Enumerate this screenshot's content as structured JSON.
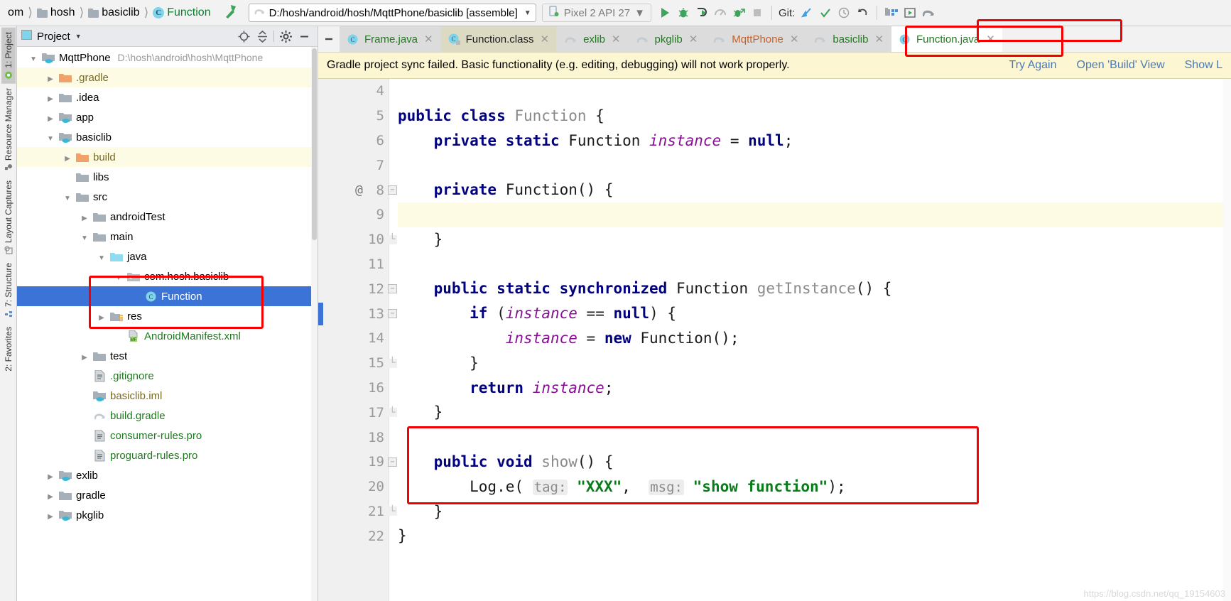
{
  "toolbar": {
    "breadcrumbs": [
      {
        "label": "om",
        "icon": "none"
      },
      {
        "label": "hosh",
        "icon": "folder-icon"
      },
      {
        "label": "basiclib",
        "icon": "folder-icon"
      },
      {
        "label": "Function",
        "icon": "class-icon"
      }
    ],
    "hammer_icon": "build-hammer-icon",
    "run_config": "D:/hosh/android/hosh/MqttPhone/basiclib [assemble]",
    "device": "Pixel 2 API 27",
    "icons": [
      "run-icon",
      "debug-icon",
      "run-with-coverage-icon",
      "profiler-icon",
      "attach-debugger-icon",
      "stop-icon"
    ],
    "git_label": "Git:",
    "git_icons": [
      "update-project-icon",
      "commit-icon",
      "history-icon",
      "rollback-icon"
    ],
    "right_icons": [
      "avd-manager-icon",
      "sdk-manager-icon",
      "gradle-sync-icon"
    ]
  },
  "vertical_tabs": [
    {
      "label": "1: Project",
      "icon": "project-icon",
      "active": true
    },
    {
      "label": "Resource Manager",
      "icon": "resource-manager-icon",
      "active": false
    },
    {
      "label": "Layout Captures",
      "icon": "layout-captures-icon",
      "active": false
    },
    {
      "label": "7: Structure",
      "icon": "structure-icon",
      "active": false
    },
    {
      "label": "2: Favorites",
      "icon": "favorites-icon",
      "active": false
    }
  ],
  "project_panel": {
    "title": "Project",
    "header_icons": [
      "locate-icon",
      "collapse-all-icon",
      "gear-icon",
      "hide-icon"
    ],
    "tree": [
      {
        "label": "MqttPhone",
        "path": "D:\\hosh\\android\\hosh\\MqttPhone",
        "indent": 0,
        "twisty": "down",
        "icon": "module-icon",
        "color": "dark",
        "state": "normal"
      },
      {
        "label": ".gradle",
        "path": "",
        "indent": 1,
        "twisty": "right",
        "icon": "orange-folder-icon",
        "color": "olive",
        "state": "yellow"
      },
      {
        "label": ".idea",
        "path": "",
        "indent": 1,
        "twisty": "right",
        "icon": "folder-icon",
        "color": "dark",
        "state": "normal"
      },
      {
        "label": "app",
        "path": "",
        "indent": 1,
        "twisty": "right",
        "icon": "module-icon",
        "color": "dark",
        "state": "normal"
      },
      {
        "label": "basiclib",
        "path": "",
        "indent": 1,
        "twisty": "down",
        "icon": "module-icon",
        "color": "dark",
        "state": "normal"
      },
      {
        "label": "build",
        "path": "",
        "indent": 2,
        "twisty": "right",
        "icon": "orange-folder-icon",
        "color": "olive",
        "state": "yellow"
      },
      {
        "label": "libs",
        "path": "",
        "indent": 2,
        "twisty": "none",
        "icon": "folder-icon",
        "color": "dark",
        "state": "normal"
      },
      {
        "label": "src",
        "path": "",
        "indent": 2,
        "twisty": "down",
        "icon": "folder-icon",
        "color": "dark",
        "state": "normal"
      },
      {
        "label": "androidTest",
        "path": "",
        "indent": 3,
        "twisty": "right",
        "icon": "folder-icon",
        "color": "dark",
        "state": "normal"
      },
      {
        "label": "main",
        "path": "",
        "indent": 3,
        "twisty": "down",
        "icon": "folder-icon",
        "color": "dark",
        "state": "normal"
      },
      {
        "label": "java",
        "path": "",
        "indent": 4,
        "twisty": "down",
        "icon": "source-folder-icon",
        "color": "dark",
        "state": "normal"
      },
      {
        "label": "com.hosh.basiclib",
        "path": "",
        "indent": 5,
        "twisty": "down",
        "icon": "package-icon",
        "color": "dark",
        "state": "normal"
      },
      {
        "label": "Function",
        "path": "",
        "indent": 6,
        "twisty": "none",
        "icon": "class-icon",
        "color": "dark",
        "state": "selected"
      },
      {
        "label": "res",
        "path": "",
        "indent": 4,
        "twisty": "right",
        "icon": "res-folder-icon",
        "color": "dark",
        "state": "normal"
      },
      {
        "label": "AndroidManifest.xml",
        "path": "",
        "indent": 5,
        "twisty": "none",
        "icon": "manifest-icon",
        "color": "green",
        "state": "normal"
      },
      {
        "label": "test",
        "path": "",
        "indent": 3,
        "twisty": "right",
        "icon": "folder-icon",
        "color": "dark",
        "state": "normal"
      },
      {
        "label": ".gitignore",
        "path": "",
        "indent": 3,
        "twisty": "none",
        "icon": "file-icon",
        "color": "green",
        "state": "normal"
      },
      {
        "label": "basiclib.iml",
        "path": "",
        "indent": 3,
        "twisty": "none",
        "icon": "module-icon",
        "color": "olive",
        "state": "normal"
      },
      {
        "label": "build.gradle",
        "path": "",
        "indent": 3,
        "twisty": "none",
        "icon": "gradle-icon",
        "color": "green",
        "state": "normal"
      },
      {
        "label": "consumer-rules.pro",
        "path": "",
        "indent": 3,
        "twisty": "none",
        "icon": "file-icon",
        "color": "green",
        "state": "normal"
      },
      {
        "label": "proguard-rules.pro",
        "path": "",
        "indent": 3,
        "twisty": "none",
        "icon": "file-icon",
        "color": "green",
        "state": "normal"
      },
      {
        "label": "exlib",
        "path": "",
        "indent": 1,
        "twisty": "right",
        "icon": "module-icon",
        "color": "dark",
        "state": "normal"
      },
      {
        "label": "gradle",
        "path": "",
        "indent": 1,
        "twisty": "right",
        "icon": "folder-icon",
        "color": "dark",
        "state": "normal"
      },
      {
        "label": "pkglib",
        "path": "",
        "indent": 1,
        "twisty": "right",
        "icon": "module-icon",
        "color": "dark",
        "state": "normal"
      }
    ]
  },
  "editor_tabs": [
    {
      "label": "Frame.java",
      "icon": "class-icon",
      "color": "green",
      "state": "inactive"
    },
    {
      "label": "Function.class",
      "icon": "class-file-icon",
      "color": "dark",
      "state": "class-active"
    },
    {
      "label": "exlib",
      "icon": "gradle-icon",
      "color": "green",
      "state": "inactive"
    },
    {
      "label": "pkglib",
      "icon": "gradle-icon",
      "color": "green",
      "state": "inactive"
    },
    {
      "label": "MqttPhone",
      "icon": "gradle-icon",
      "color": "orange",
      "state": "inactive"
    },
    {
      "label": "basiclib",
      "icon": "gradle-icon",
      "color": "green",
      "state": "inactive"
    },
    {
      "label": "Function.java",
      "icon": "class-icon",
      "color": "green",
      "state": "active"
    }
  ],
  "banner": {
    "message": "Gradle project sync failed. Basic functionality (e.g. editing, debugging) will not work properly.",
    "actions": [
      "Try Again",
      "Open 'Build' View",
      "Show L"
    ]
  },
  "editor": {
    "lines": [
      {
        "n": "4",
        "ann": "",
        "fold": "none",
        "highlight": false,
        "tokens": []
      },
      {
        "n": "5",
        "ann": "",
        "fold": "none",
        "highlight": false,
        "tokens": [
          {
            "t": "public class ",
            "c": "kw"
          },
          {
            "t": "Function ",
            "c": "id-gray"
          },
          {
            "t": "{",
            "c": "plain"
          }
        ]
      },
      {
        "n": "6",
        "ann": "",
        "fold": "none",
        "highlight": false,
        "tokens": [
          {
            "t": "    ",
            "c": "plain"
          },
          {
            "t": "private static ",
            "c": "kw"
          },
          {
            "t": "Function ",
            "c": "plain"
          },
          {
            "t": "instance",
            "c": "fld"
          },
          {
            "t": " = ",
            "c": "plain"
          },
          {
            "t": "null",
            "c": "kw"
          },
          {
            "t": ";",
            "c": "plain"
          }
        ]
      },
      {
        "n": "7",
        "ann": "",
        "fold": "none",
        "highlight": false,
        "tokens": []
      },
      {
        "n": "8",
        "ann": "@",
        "fold": "minus",
        "highlight": false,
        "tokens": [
          {
            "t": "    ",
            "c": "plain"
          },
          {
            "t": "private ",
            "c": "kw"
          },
          {
            "t": "Function() {",
            "c": "plain"
          }
        ]
      },
      {
        "n": "9",
        "ann": "",
        "fold": "none",
        "highlight": true,
        "tokens": []
      },
      {
        "n": "10",
        "ann": "",
        "fold": "end",
        "highlight": false,
        "tokens": [
          {
            "t": "    }",
            "c": "plain"
          }
        ]
      },
      {
        "n": "11",
        "ann": "",
        "fold": "none",
        "highlight": false,
        "tokens": []
      },
      {
        "n": "12",
        "ann": "",
        "fold": "minus",
        "highlight": false,
        "tokens": [
          {
            "t": "    ",
            "c": "plain"
          },
          {
            "t": "public static synchronized ",
            "c": "kw"
          },
          {
            "t": "Function ",
            "c": "plain"
          },
          {
            "t": "getInstance",
            "c": "id-gray"
          },
          {
            "t": "() {",
            "c": "plain"
          }
        ]
      },
      {
        "n": "13",
        "ann": "",
        "fold": "minus",
        "highlight": false,
        "tokens": [
          {
            "t": "        ",
            "c": "plain"
          },
          {
            "t": "if ",
            "c": "kw"
          },
          {
            "t": "(",
            "c": "plain"
          },
          {
            "t": "instance",
            "c": "fld"
          },
          {
            "t": " == ",
            "c": "plain"
          },
          {
            "t": "null",
            "c": "kw"
          },
          {
            "t": ") {",
            "c": "plain"
          }
        ]
      },
      {
        "n": "14",
        "ann": "",
        "fold": "none",
        "highlight": false,
        "tokens": [
          {
            "t": "            ",
            "c": "plain"
          },
          {
            "t": "instance",
            "c": "fld"
          },
          {
            "t": " = ",
            "c": "plain"
          },
          {
            "t": "new ",
            "c": "kw"
          },
          {
            "t": "Function();",
            "c": "plain"
          }
        ]
      },
      {
        "n": "15",
        "ann": "",
        "fold": "end",
        "highlight": false,
        "tokens": [
          {
            "t": "        }",
            "c": "plain"
          }
        ]
      },
      {
        "n": "16",
        "ann": "",
        "fold": "none",
        "highlight": false,
        "tokens": [
          {
            "t": "        ",
            "c": "plain"
          },
          {
            "t": "return ",
            "c": "kw"
          },
          {
            "t": "instance",
            "c": "fld"
          },
          {
            "t": ";",
            "c": "plain"
          }
        ]
      },
      {
        "n": "17",
        "ann": "",
        "fold": "end",
        "highlight": false,
        "tokens": [
          {
            "t": "    }",
            "c": "plain"
          }
        ]
      },
      {
        "n": "18",
        "ann": "",
        "fold": "none",
        "highlight": false,
        "tokens": []
      },
      {
        "n": "19",
        "ann": "",
        "fold": "minus",
        "highlight": false,
        "tokens": [
          {
            "t": "    ",
            "c": "plain"
          },
          {
            "t": "public void ",
            "c": "kw"
          },
          {
            "t": "show",
            "c": "id-gray"
          },
          {
            "t": "() {",
            "c": "plain"
          }
        ]
      },
      {
        "n": "20",
        "ann": "",
        "fold": "none",
        "highlight": false,
        "tokens": [
          {
            "t": "        Log.e( ",
            "c": "plain"
          },
          {
            "t": "tag:",
            "c": "hint"
          },
          {
            "t": " ",
            "c": "plain"
          },
          {
            "t": "\"XXX\"",
            "c": "str"
          },
          {
            "t": ",  ",
            "c": "plain"
          },
          {
            "t": "msg:",
            "c": "hint"
          },
          {
            "t": " ",
            "c": "plain"
          },
          {
            "t": "\"show function\"",
            "c": "str"
          },
          {
            "t": ");",
            "c": "plain"
          }
        ]
      },
      {
        "n": "21",
        "ann": "",
        "fold": "end",
        "highlight": false,
        "tokens": [
          {
            "t": "    }",
            "c": "plain"
          }
        ]
      },
      {
        "n": "22",
        "ann": "",
        "fold": "none",
        "highlight": false,
        "tokens": [
          {
            "t": "}",
            "c": "plain"
          }
        ]
      }
    ]
  },
  "watermark": "https://blog.csdn.net/qq_19154603",
  "colors": {
    "annotation_red": "#f40000",
    "selection_blue": "#3b74d6",
    "banner_bg": "#fdf6d3",
    "keyword": "#000080",
    "string": "#067d17",
    "field": "#871094"
  }
}
